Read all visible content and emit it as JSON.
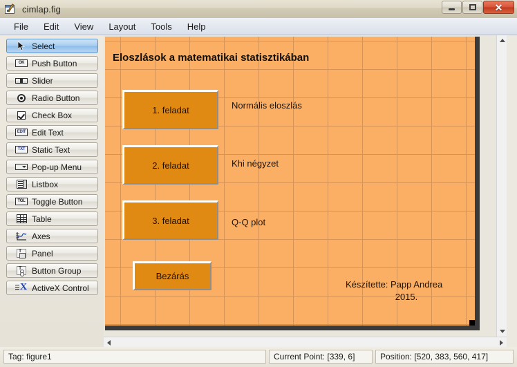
{
  "window": {
    "title": "cimlap.fig",
    "icon": "guide-layout-editor-icon",
    "minimize_label": "",
    "maximize_label": "",
    "close_label": "✕"
  },
  "menubar": {
    "items": [
      {
        "label": "File"
      },
      {
        "label": "Edit"
      },
      {
        "label": "View"
      },
      {
        "label": "Layout"
      },
      {
        "label": "Tools"
      },
      {
        "label": "Help"
      }
    ]
  },
  "palette": {
    "items": [
      {
        "label": "Select",
        "icon": "cursor-arrow-icon",
        "selected": true
      },
      {
        "label": "Push Button",
        "icon": "push-button-icon",
        "selected": false
      },
      {
        "label": "Slider",
        "icon": "slider-icon",
        "selected": false
      },
      {
        "label": "Radio Button",
        "icon": "radio-button-icon",
        "selected": false
      },
      {
        "label": "Check Box",
        "icon": "check-box-icon",
        "selected": false
      },
      {
        "label": "Edit Text",
        "icon": "edit-text-icon",
        "selected": false
      },
      {
        "label": "Static Text",
        "icon": "static-text-icon",
        "selected": false
      },
      {
        "label": "Pop-up Menu",
        "icon": "popup-menu-icon",
        "selected": false
      },
      {
        "label": "Listbox",
        "icon": "listbox-icon",
        "selected": false
      },
      {
        "label": "Toggle Button",
        "icon": "toggle-button-icon",
        "selected": false
      },
      {
        "label": "Table",
        "icon": "table-icon",
        "selected": false
      },
      {
        "label": "Axes",
        "icon": "axes-icon",
        "selected": false
      },
      {
        "label": "Panel",
        "icon": "panel-icon",
        "selected": false
      },
      {
        "label": "Button Group",
        "icon": "button-group-icon",
        "selected": false
      },
      {
        "label": "ActiveX Control",
        "icon": "activex-control-icon",
        "selected": false
      }
    ],
    "icon_glyphs": {
      "push_button": "OK",
      "edit_text": "EDIT",
      "static_text": "TXT",
      "toggle_button": "TGL",
      "panel": "T",
      "button_group": "T",
      "activex": "X"
    }
  },
  "figure": {
    "background_color": "#faaf64",
    "grid_color": "#d59455",
    "button_color": "#e08a14",
    "title": "Eloszlások a matematikai statisztikában",
    "buttons": [
      {
        "label": "1. feladat"
      },
      {
        "label": "2. feladat"
      },
      {
        "label": "3. feladat"
      },
      {
        "label": "Bezárás"
      }
    ],
    "labels": [
      {
        "text": "Normális eloszlás"
      },
      {
        "text": "Khi négyzet"
      },
      {
        "text": "Q-Q plot"
      }
    ],
    "credit": {
      "line1": "Készítette: Papp Andrea",
      "line2": "2015."
    }
  },
  "statusbar": {
    "tag": "Tag: figure1",
    "current_point": "Current Point:  [339, 6]",
    "position": "Position: [520, 383, 560, 417]"
  }
}
